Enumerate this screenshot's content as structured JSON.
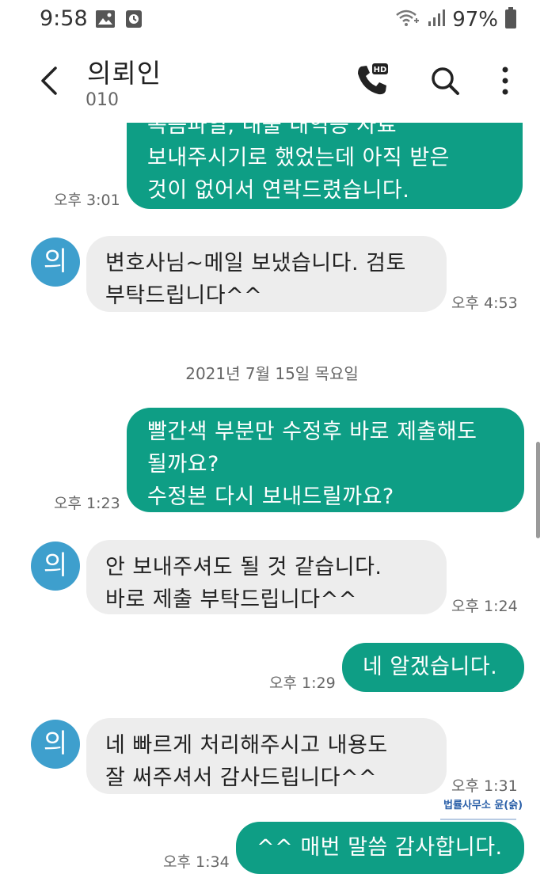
{
  "status_bar": {
    "time": "9:58",
    "battery": "97%",
    "icons": [
      "image-notification-icon",
      "app-notification-icon",
      "wifi-calling-icon",
      "signal-icon",
      "battery-icon"
    ]
  },
  "header": {
    "contact_name": "의뢰인",
    "contact_number": "010",
    "back_icon": "chevron-left-icon",
    "call_icon": "hd-call-icon",
    "search_icon": "search-icon",
    "more_icon": "more-vertical-icon"
  },
  "colors": {
    "outgoing_bubble": "#0e9e85",
    "incoming_bubble": "#ededed",
    "avatar": "#3e9fcd"
  },
  "messages": [
    {
      "id": "m1",
      "direction": "out",
      "text": "녹음파일, 내출 내역등 자료\n보내주시기로 했었는데 아직 받은\n것이 없어서 연락드렸습니다.",
      "time": "오후 3:01"
    },
    {
      "id": "m2",
      "direction": "in",
      "avatar": "의",
      "text": "변호사님~메일 보냈습니다. 검토\n부탁드립니다^^",
      "time": "오후 4:53"
    },
    {
      "id": "date",
      "type": "date_separator",
      "text": "2021년 7월 15일 목요일"
    },
    {
      "id": "m3",
      "direction": "out",
      "text": "빨간색 부분만 수정후 바로 제출해도\n될까요?\n수정본 다시 보내드릴까요?",
      "time": "오후 1:23"
    },
    {
      "id": "m4",
      "direction": "in",
      "avatar": "의",
      "text": "안 보내주셔도 될 것 같습니다.\n바로 제출 부탁드립니다^^",
      "time": "오후 1:24"
    },
    {
      "id": "m5",
      "direction": "out",
      "text": "네 알겠습니다.",
      "time": "오후 1:29"
    },
    {
      "id": "m6",
      "direction": "in",
      "avatar": "의",
      "text": "네 빠르게 처리해주시고 내용도\n잘 써주셔서 감사드립니다^^",
      "time": "오후 1:31"
    },
    {
      "id": "m7",
      "direction": "out",
      "text": "^^ 매번 말씀 감사합니다.",
      "time": "오후 1:34"
    }
  ],
  "watermark": "법률사무소 윤(슭)"
}
